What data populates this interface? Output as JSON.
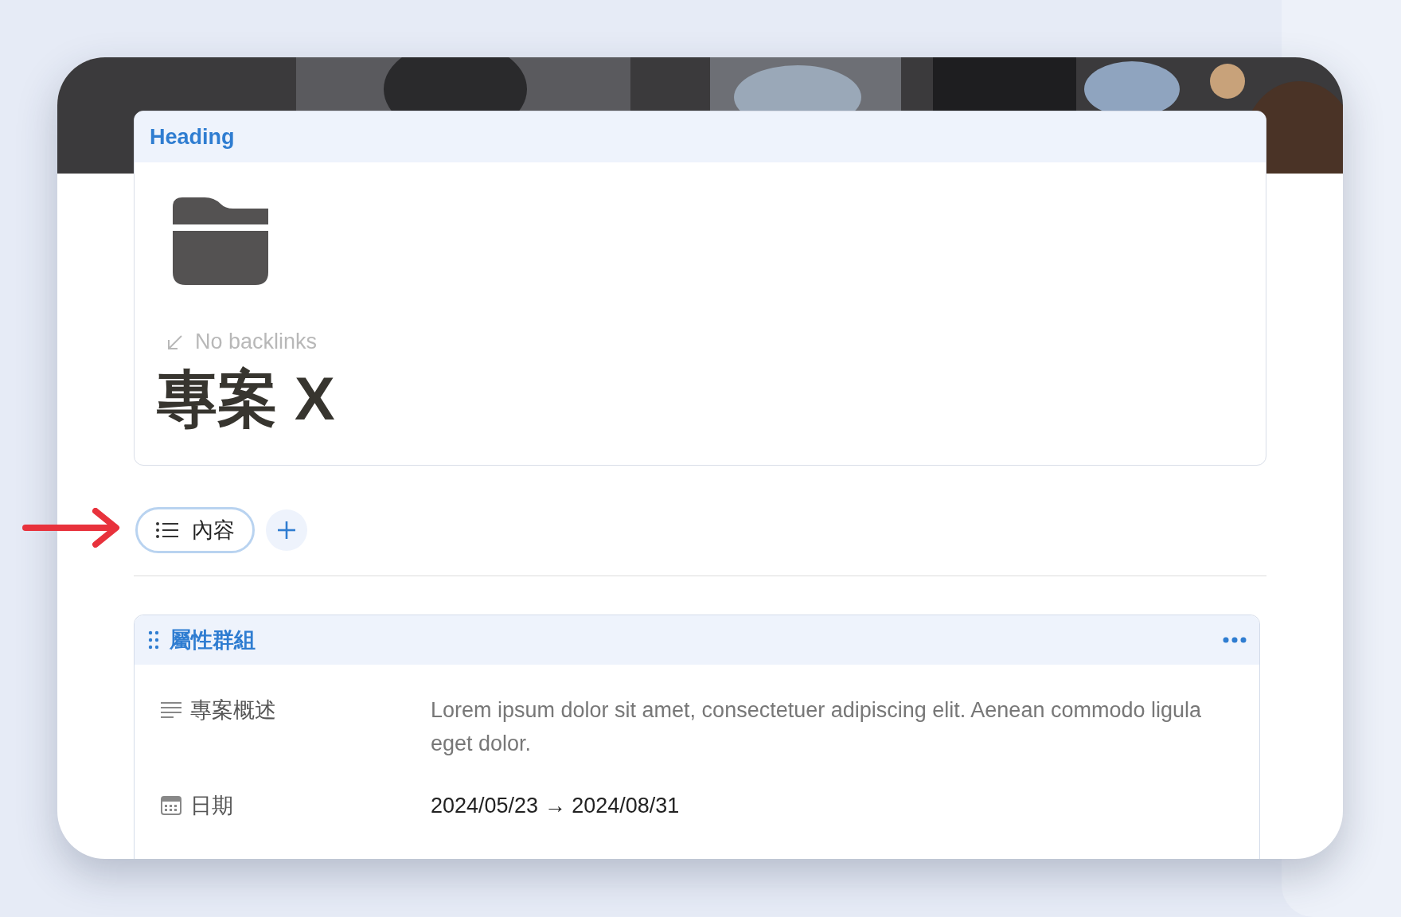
{
  "heading_card": {
    "label": "Heading",
    "backlinks": "No backlinks",
    "title": "專案 X"
  },
  "tabs": [
    {
      "label": "內容",
      "selected": true
    }
  ],
  "property_group": {
    "title": "屬性群組",
    "properties": [
      {
        "kind": "text",
        "name": "專案概述",
        "value": "Lorem ipsum dolor sit amet, consectetuer adipiscing elit. Aenean commodo ligula eget dolor."
      },
      {
        "kind": "date",
        "name": "日期",
        "value": "2024/05/23 → 2024/08/31"
      }
    ]
  }
}
